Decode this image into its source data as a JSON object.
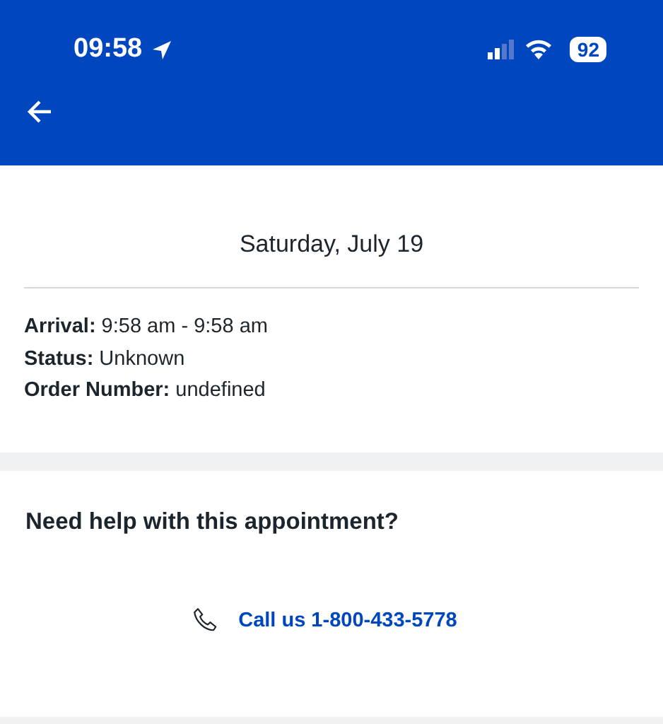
{
  "status_bar": {
    "time": "09:58",
    "battery": "92"
  },
  "appointment": {
    "date": "Saturday, July 19",
    "details": [
      "**Arrival:** 9:58 am - 9:58 am",
      "**Status:** Unknown",
      "**Order Number:** undefined"
    ]
  },
  "help": {
    "heading": "Need help with this appointment?",
    "call_link": "Call us 1-800-433-5778"
  }
}
